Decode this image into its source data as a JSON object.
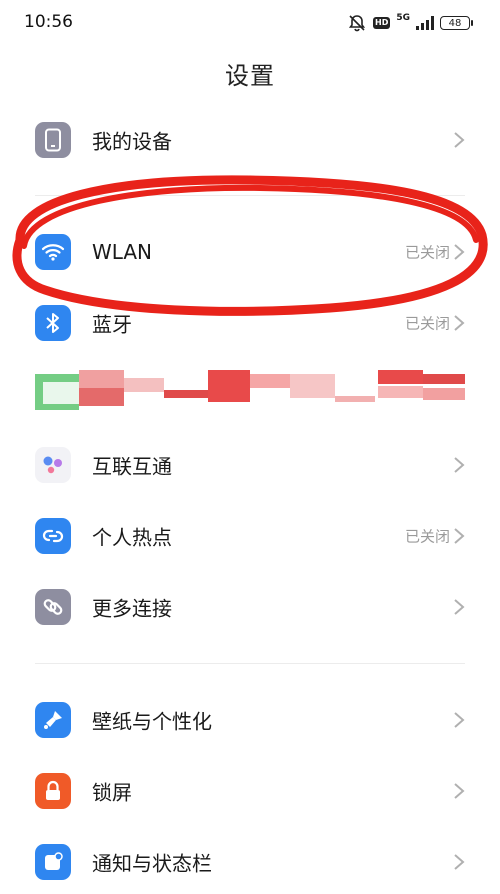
{
  "status_bar": {
    "time": "10:56",
    "hd": "HD",
    "network": "5G",
    "battery": "48"
  },
  "title": "设置",
  "rows": [
    {
      "label": "我的设备",
      "value": "",
      "icon": "phone-icon",
      "color": "#8e8ea0"
    },
    {
      "label": "WLAN",
      "value": "已关闭",
      "icon": "wifi-icon",
      "color": "#2f86f0"
    },
    {
      "label": "蓝牙",
      "value": "已关闭",
      "icon": "bluetooth-icon",
      "color": "#2f86f0"
    },
    {
      "label": "互联互通",
      "value": "",
      "icon": "dots-icon",
      "color": "#f2f2f6"
    },
    {
      "label": "个人热点",
      "value": "已关闭",
      "icon": "hotspot-icon",
      "color": "#2f86f0"
    },
    {
      "label": "更多连接",
      "value": "",
      "icon": "link-icon",
      "color": "#8e8ea0"
    },
    {
      "label": "壁纸与个性化",
      "value": "",
      "icon": "brush-icon",
      "color": "#2f86f0"
    },
    {
      "label": "锁屏",
      "value": "",
      "icon": "lock-icon",
      "color": "#f05a28"
    },
    {
      "label": "通知与状态栏",
      "value": "",
      "icon": "notification-icon",
      "color": "#2f86f0"
    }
  ],
  "annotation_color": "#e8231a"
}
